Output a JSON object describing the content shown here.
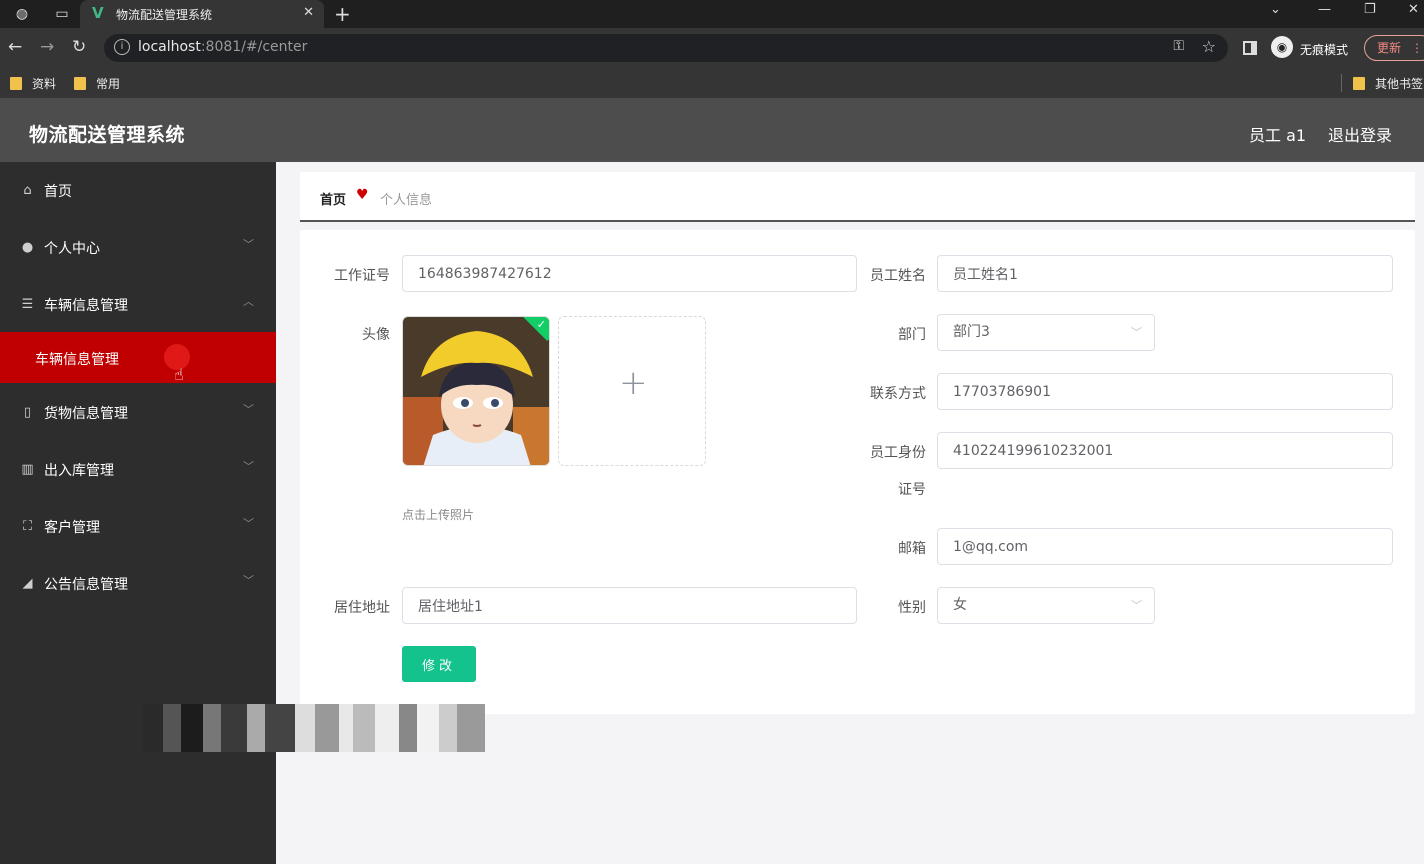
{
  "browser": {
    "tab_title": "物流配送管理系统",
    "tab_favicon": "V",
    "url_host": "localhost",
    "url_rest": ":8081/#/center",
    "incognito_label": "无痕模式",
    "update_label": "更新",
    "bookmarks": [
      "资料",
      "常用"
    ],
    "other_bookmarks": "其他书签"
  },
  "header": {
    "title": "物流配送管理系统",
    "user": "员工 a1",
    "logout": "退出登录"
  },
  "sidebar": {
    "items": [
      {
        "label": "首页",
        "icon": "home-icon"
      },
      {
        "label": "个人中心",
        "icon": "user-icon"
      },
      {
        "label": "车辆信息管理",
        "icon": "sliders-icon"
      },
      {
        "label": "车辆信息管理",
        "icon": "",
        "active": true
      },
      {
        "label": "货物信息管理",
        "icon": "phone-icon"
      },
      {
        "label": "出入库管理",
        "icon": "books-icon"
      },
      {
        "label": "客户管理",
        "icon": "frame-icon"
      },
      {
        "label": "公告信息管理",
        "icon": "megaphone-icon"
      }
    ]
  },
  "breadcrumb": {
    "home": "首页",
    "current": "个人信息"
  },
  "form": {
    "work_id_label": "工作证号",
    "work_id_value": "164863987427612",
    "name_label": "员工姓名",
    "name_value": "员工姓名1",
    "avatar_label": "头像",
    "upload_tip": "点击上传照片",
    "dept_label": "部门",
    "dept_value": "部门3",
    "phone_label": "联系方式",
    "phone_value": "17703786901",
    "idcard_label_1": "员工身份",
    "idcard_label_2": "证号",
    "idcard_value": "410224199610232001",
    "email_label": "邮箱",
    "email_value": "1@qq.com",
    "address_label": "居住地址",
    "address_value": "居住地址1",
    "gender_label": "性别",
    "gender_value": "女",
    "submit_label": "修改"
  },
  "colors": {
    "header_bg": "#4d4d4d",
    "sidebar_bg": "#2d2d2d",
    "active_menu": "#c00000",
    "submit_btn": "#13c28c",
    "heart": "#d00000"
  }
}
